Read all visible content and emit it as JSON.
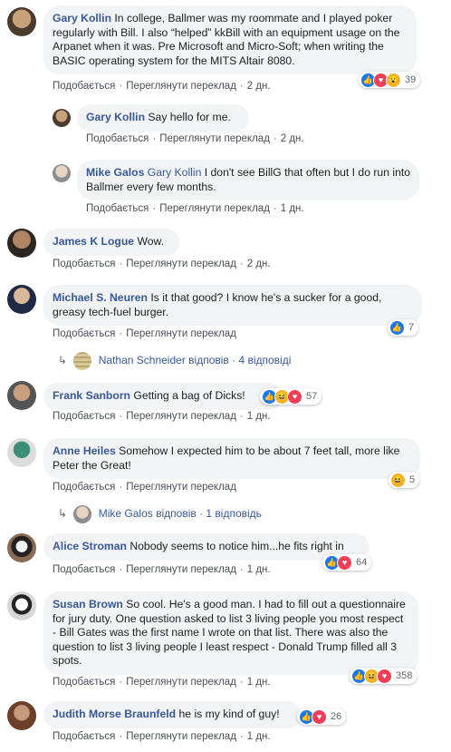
{
  "actions": {
    "like": "Подобається",
    "translation": "Переглянути переклад",
    "sep": "·"
  },
  "comments": [
    {
      "author": "Gary Kollin",
      "text": "In college, Ballmer was my roommate and I played poker regularly with Bill. I also “helped” kkBill with an equipment usage on the Arpanet when it was. Pre Microsoft and Micro-Soft; when writing the BASIC operating system for the MITS Altair 8080.",
      "time": "2 дн.",
      "reactions": "39"
    },
    {
      "author": "Gary Kollin",
      "text": "Say hello for me.",
      "time": "2 дн."
    },
    {
      "author": "Mike Galos",
      "tag": "Gary Kollin",
      "text": "I don't see BillG that often but I do run into Ballmer every few months.",
      "time": "1 дн."
    },
    {
      "author": "James K Logue",
      "text": "Wow.",
      "time": "2 дн."
    },
    {
      "author": "Michael S. Neuren",
      "text": "Is it that good? I know he's a sucker for a good, greasy tech-fuel burger.",
      "time": "",
      "reactions": "7",
      "replies": "Nathan Schneider відповів · 4 відповіді"
    },
    {
      "author": "Frank Sanborn",
      "text": "Getting a bag of Dicks!",
      "time": "1 дн.",
      "reactions": "57"
    },
    {
      "author": "Anne Heiles",
      "text": "Somehow I expected him to be about 7 feet tall, more like Peter the Great!",
      "time": "",
      "reactions": "5",
      "replies": "Mike Galos відповів · 1 відповідь"
    },
    {
      "author": "Alice Stroman",
      "text": "Nobody seems to notice him...he fits right in",
      "time": "1 дн.",
      "reactions": "64"
    },
    {
      "author": "Susan Brown",
      "text": "So cool. He's a good man. I had to fill out a questionnaire for jury duty. One question asked to list 3 living people you most respect - Bill Gates was the first name I wrote on that list. There was also the question to list 3 living people I least respect - Donald Trump filled all 3 spots.",
      "time": "1 дн.",
      "reactions": "358"
    },
    {
      "author": "Judith Morse Braunfeld",
      "text": "he is my kind of guy!",
      "time": "1 дн.",
      "reactions": "26"
    }
  ]
}
